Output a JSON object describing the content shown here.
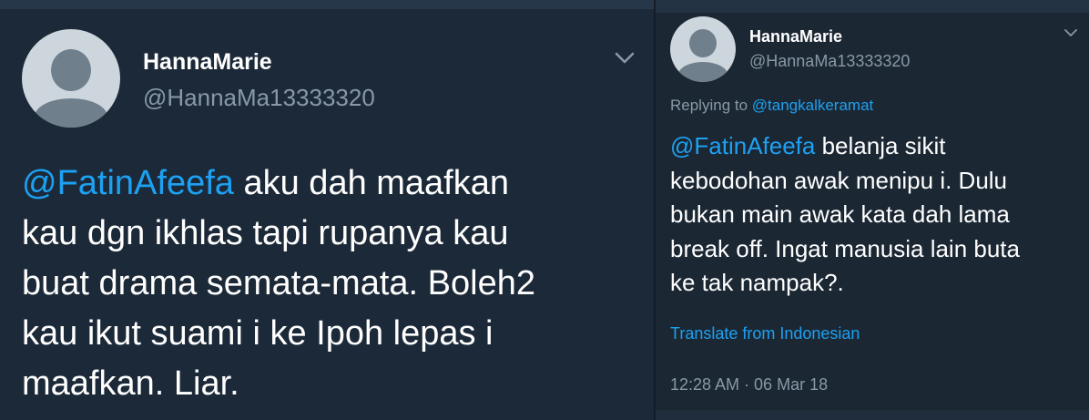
{
  "left_tweet": {
    "display_name": "HannaMarie",
    "handle": "@HannaMa13333320",
    "mention": "@FatinAfeefa",
    "lines": [
      " aku dah maafkan",
      "kau dgn ikhlas tapi rupanya kau",
      "buat drama semata-mata. Boleh2",
      "kau ikut suami i ke Ipoh lepas i",
      "maafkan. Liar."
    ]
  },
  "right_tweet": {
    "display_name": "HannaMarie",
    "handle": "@HannaMa13333320",
    "replying_prefix": "Replying to ",
    "replying_to": "@tangkalkeramat",
    "mention": "@FatinAfeefa",
    "lines": [
      " belanja sikit",
      "kebodohan awak menipu i. Dulu",
      "bukan main awak kata dah lama",
      "break off. Ingat manusia lain buta",
      "ke tak nampak?."
    ],
    "translate": "Translate from Indonesian",
    "timestamp": "12:28 AM · 06 Mar 18"
  },
  "colors": {
    "background": "#1c2938",
    "accent": "#1da1f2",
    "secondary_text": "#8899a6"
  },
  "icons": [
    "avatar-placeholder",
    "chevron-down-icon"
  ]
}
